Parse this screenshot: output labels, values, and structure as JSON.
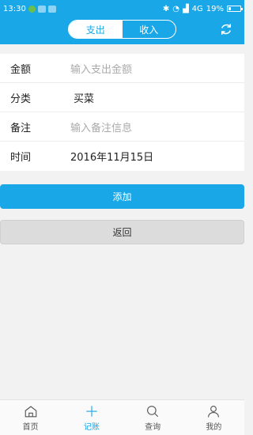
{
  "status_bar": {
    "time": "13:30",
    "network": "4G",
    "battery": "19%"
  },
  "header": {
    "tabs": [
      {
        "label": "支出",
        "active": true
      },
      {
        "label": "收入",
        "active": false
      }
    ]
  },
  "form": {
    "amount": {
      "label": "金额",
      "placeholder": "输入支出金额"
    },
    "category": {
      "label": "分类",
      "value": "买菜"
    },
    "note": {
      "label": "备注",
      "placeholder": "输入备注信息"
    },
    "time": {
      "label": "时间",
      "value": "2016年11月15日"
    }
  },
  "buttons": {
    "add": "添加",
    "back": "返回"
  },
  "tabbar": {
    "items": [
      {
        "label": "首页",
        "icon": "home-icon"
      },
      {
        "label": "记账",
        "icon": "plus-icon",
        "active": true
      },
      {
        "label": "查询",
        "icon": "search-icon"
      },
      {
        "label": "我的",
        "icon": "user-icon"
      }
    ]
  },
  "colors": {
    "accent": "#1aa7e8",
    "background": "#f2f2f2"
  }
}
